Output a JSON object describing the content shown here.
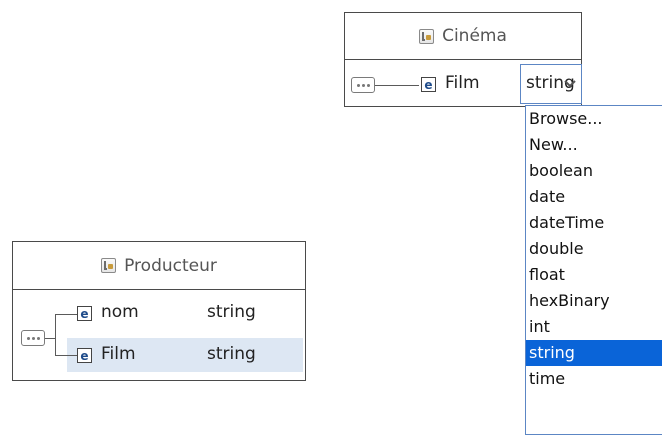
{
  "cinema": {
    "title": "Cinéma",
    "element": {
      "name": "Film",
      "type": "string"
    },
    "type_dropdown": {
      "selected": "string",
      "options": [
        "Browse...",
        "New...",
        "boolean",
        "date",
        "dateTime",
        "double",
        "float",
        "hexBinary",
        "int",
        "string",
        "time"
      ]
    }
  },
  "producteur": {
    "title": "Producteur",
    "elements": [
      {
        "name": "nom",
        "type": "string"
      },
      {
        "name": "Film",
        "type": "string"
      }
    ]
  },
  "colors": {
    "selection": "#0a64d8",
    "row_highlight": "#dde7f3",
    "element_icon_letter": "#1e4b8a"
  },
  "icons": {
    "complex_type": "complex-type-icon",
    "sequence": "sequence-compositor-icon",
    "element": "element-icon",
    "dropdown": "chevron-down-icon"
  }
}
